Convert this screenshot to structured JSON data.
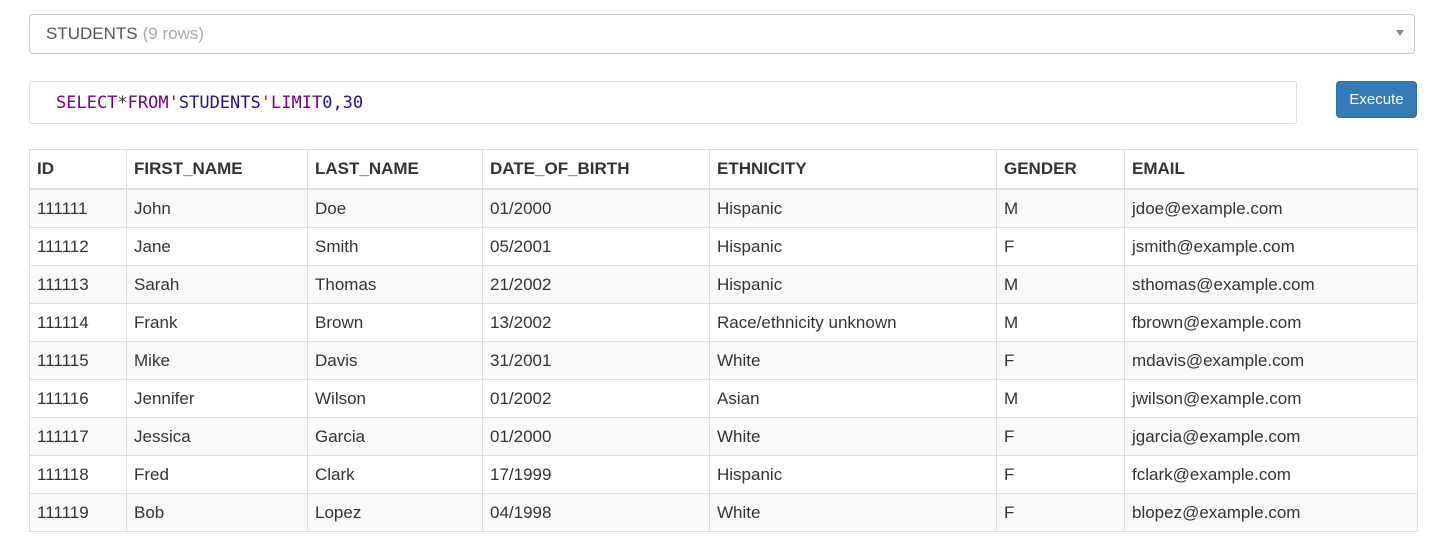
{
  "table_select": {
    "name": "STUDENTS",
    "rows_label": "(9 rows)"
  },
  "query": {
    "select_kw": "SELECT",
    "star": "*",
    "from_kw": "FROM",
    "open_quote": "'",
    "table": "STUDENTS",
    "close_quote": "'",
    "limit_kw": "LIMIT",
    "limit_value": "0,30"
  },
  "execute_label": "Execute",
  "columns": [
    "ID",
    "FIRST_NAME",
    "LAST_NAME",
    "DATE_OF_BIRTH",
    "ETHNICITY",
    "GENDER",
    "EMAIL"
  ],
  "rows": [
    [
      "111111",
      "John",
      "Doe",
      "01/2000",
      "Hispanic",
      "M",
      "jdoe@example.com"
    ],
    [
      "111112",
      "Jane",
      "Smith",
      "05/2001",
      "Hispanic",
      "F",
      "jsmith@example.com"
    ],
    [
      "111113",
      "Sarah",
      "Thomas",
      "21/2002",
      "Hispanic",
      "M",
      "sthomas@example.com"
    ],
    [
      "111114",
      "Frank",
      "Brown",
      "13/2002",
      "Race/ethnicity unknown",
      "M",
      "fbrown@example.com"
    ],
    [
      "111115",
      "Mike",
      "Davis",
      "31/2001",
      "White",
      "F",
      "mdavis@example.com"
    ],
    [
      "111116",
      "Jennifer",
      "Wilson",
      "01/2002",
      "Asian",
      "M",
      "jwilson@example.com"
    ],
    [
      "111117",
      "Jessica",
      "Garcia",
      "01/2000",
      "White",
      "F",
      "jgarcia@example.com"
    ],
    [
      "111118",
      "Fred",
      "Clark",
      "17/1999",
      "Hispanic",
      "F",
      "fclark@example.com"
    ],
    [
      "111119",
      "Bob",
      "Lopez",
      "04/1998",
      "White",
      "F",
      "blopez@example.com"
    ]
  ]
}
